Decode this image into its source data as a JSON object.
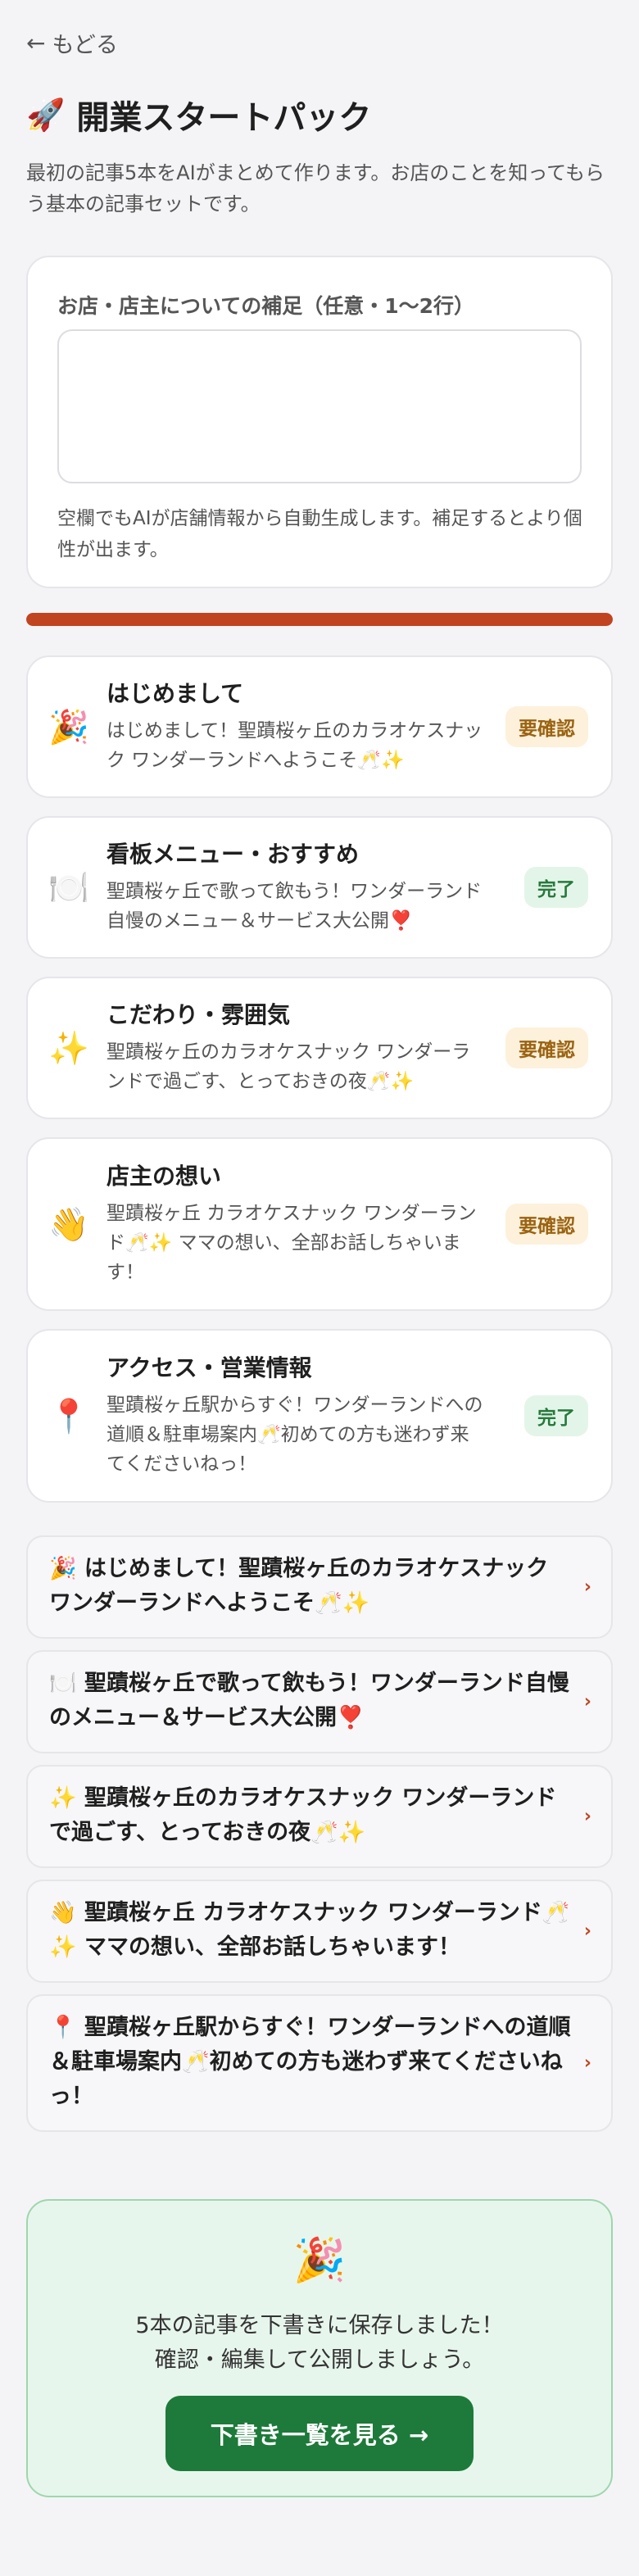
{
  "nav": {
    "back_arrow": "←",
    "back_label": "もどる"
  },
  "header": {
    "icon": "🚀",
    "title": "開業スタートパック"
  },
  "intro": "最初の記事5本をAIがまとめて作ります。お店のことを知ってもらう基本の記事セットです。",
  "supplement": {
    "label": "お店・店主についての補足（任意・1〜2行）",
    "value": "",
    "placeholder": "",
    "note": "空欄でもAIが店舗情報から自動生成します。補足するとより個性が出ます。"
  },
  "progress": {
    "percent": 100,
    "color": "#c0441f"
  },
  "articles": [
    {
      "icon": "🎉",
      "name": "はじめまして",
      "desc": "はじめまして！聖蹟桜ヶ丘のカラオケスナック ワンダーランドへようこそ🥂✨",
      "status": "要確認",
      "state": "pending"
    },
    {
      "icon": "🍽️",
      "name": "看板メニュー・おすすめ",
      "desc": "聖蹟桜ヶ丘で歌って飲もう！ワンダーランド自慢のメニュー＆サービス大公開❣️",
      "status": "完了",
      "state": "done"
    },
    {
      "icon": "✨",
      "name": "こだわり・雰囲気",
      "desc": "聖蹟桜ヶ丘のカラオケスナック ワンダーランドで過ごす、とっておきの夜🥂✨",
      "status": "要確認",
      "state": "pending"
    },
    {
      "icon": "👋",
      "name": "店主の想い",
      "desc": "聖蹟桜ヶ丘 カラオケスナック ワンダーランド🥂✨ ママの想い、全部お話しちゃいます！",
      "status": "要確認",
      "state": "pending"
    },
    {
      "icon": "📍",
      "name": "アクセス・営業情報",
      "desc": "聖蹟桜ヶ丘駅からすぐ！ワンダーランドへの道順＆駐車場案内🥂初めての方も迷わず来てくださいねっ！",
      "status": "完了",
      "state": "done"
    }
  ],
  "drafts": [
    {
      "text": "🎉 はじめまして！聖蹟桜ヶ丘のカラオケスナック ワンダーランドへようこそ🥂✨"
    },
    {
      "text": "🍽️ 聖蹟桜ヶ丘で歌って飲もう！ワンダーランド自慢のメニュー＆サービス大公開❣️"
    },
    {
      "text": "✨ 聖蹟桜ヶ丘のカラオケスナック ワンダーランドで過ごす、とっておきの夜🥂✨"
    },
    {
      "text": "👋 聖蹟桜ヶ丘 カラオケスナック ワンダーランド🥂✨ ママの想い、全部お話しちゃいます！"
    },
    {
      "text": "📍 聖蹟桜ヶ丘駅からすぐ！ワンダーランドへの道順＆駐車場案内🥂初めての方も迷わず来てくださいねっ！"
    }
  ],
  "chevron": "›",
  "completion": {
    "icon": "🎉",
    "line1": "5本の記事を下書きに保存しました！",
    "line2": "確認・編集して公開しましょう。",
    "button": "下書き一覧を見る →"
  },
  "colors": {
    "accent": "#c0441f",
    "success": "#1d7a3a",
    "pending_bg": "#fdf1dc",
    "done_bg": "#e3f5e8"
  }
}
